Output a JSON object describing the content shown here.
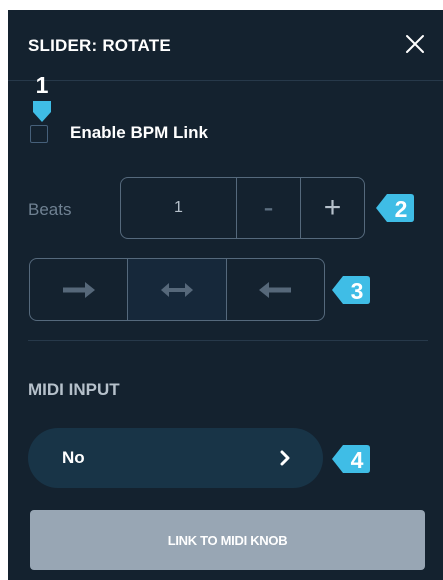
{
  "panel": {
    "title": "SLIDER: ROTATE",
    "close_icon": "close-icon"
  },
  "markers": {
    "m1": "1",
    "m2": "2",
    "m3": "3",
    "m4": "4",
    "accent": "#3fbde6"
  },
  "bpm_link": {
    "label": "Enable BPM Link",
    "checked": false
  },
  "beats": {
    "label": "Beats",
    "value": "1",
    "minus_label": "-",
    "plus_label": "+"
  },
  "direction": {
    "options": [
      "arrow-right-icon",
      "arrow-left-right-icon",
      "arrow-left-icon"
    ],
    "selected": "arrow-left-right-icon"
  },
  "midi": {
    "section_label": "MIDI INPUT",
    "value": "No",
    "chevron_icon": "chevron-right-icon",
    "link_button": "LINK TO MIDI KNOB"
  }
}
